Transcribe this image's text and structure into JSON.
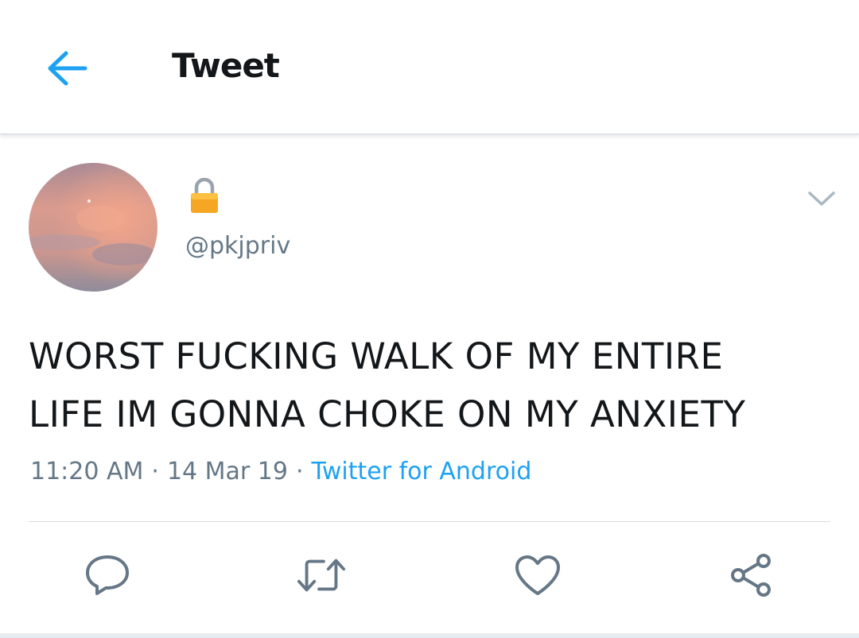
{
  "header": {
    "title": "Tweet",
    "back_icon": "arrow-left-icon"
  },
  "author": {
    "protected_icon": "lock-icon",
    "handle": "@pkjpriv",
    "avatar_description_colors": [
      "#e8927f",
      "#c98a8a",
      "#8e8fa3"
    ]
  },
  "tweet": {
    "text": "WORST FUCKING WALK OF MY ENTIRE\nLIFE IM GONNA CHOKE ON MY ANXIETY",
    "time": "11:20 AM",
    "date": "14 Mar 19",
    "separator": "·",
    "source": "Twitter for Android"
  },
  "actions": [
    {
      "name": "reply",
      "icon": "reply-icon"
    },
    {
      "name": "retweet",
      "icon": "retweet-icon"
    },
    {
      "name": "like",
      "icon": "heart-icon"
    },
    {
      "name": "share",
      "icon": "share-icon"
    }
  ],
  "colors": {
    "accent": "#1da1f2",
    "text_primary": "#14171a",
    "text_secondary": "#657786",
    "icon_gray": "#657786",
    "lock_gold": "#f5a623"
  }
}
